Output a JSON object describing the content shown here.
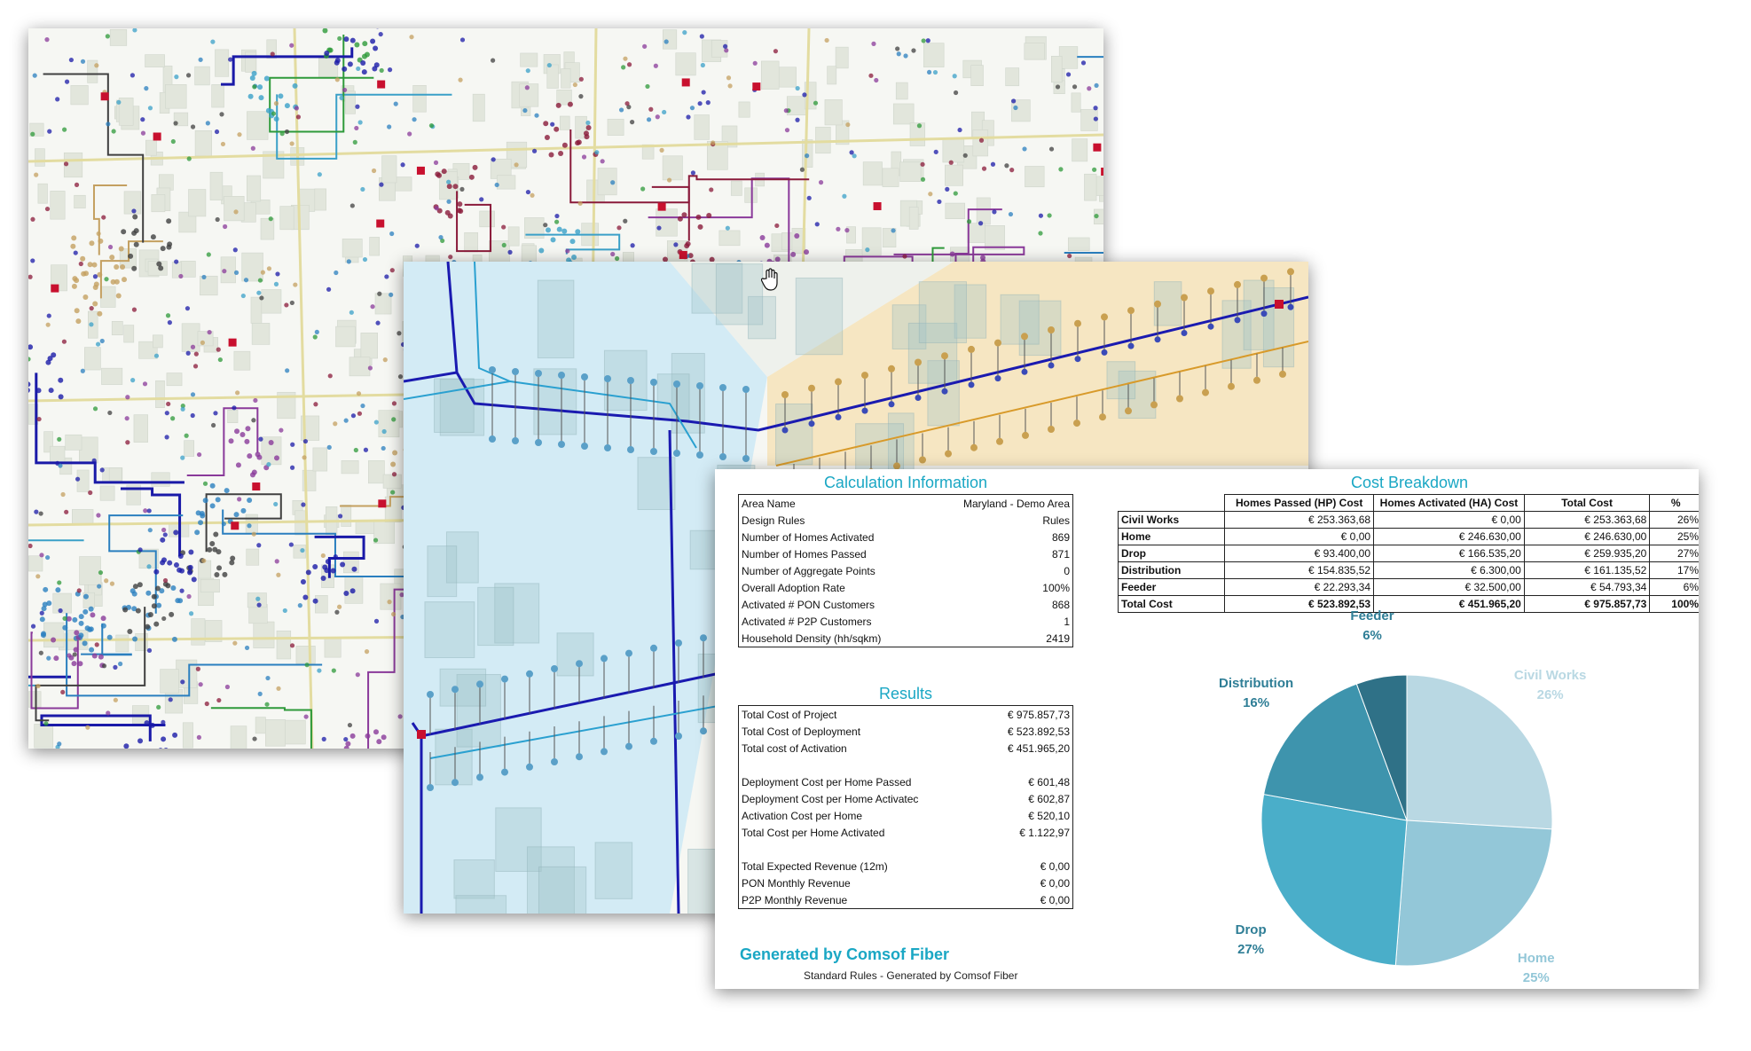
{
  "calculation": {
    "title": "Calculation Information",
    "rows": [
      {
        "label": "Area Name",
        "value": "Maryland - Demo Area"
      },
      {
        "label": "Design Rules",
        "value": "Rules"
      },
      {
        "label": "Number of Homes Activated",
        "value": "869"
      },
      {
        "label": "Number of Homes Passed",
        "value": "871"
      },
      {
        "label": "Number of Aggregate Points",
        "value": "0"
      },
      {
        "label": "Overall Adoption Rate",
        "value": "100%"
      },
      {
        "label": "Activated # PON Customers",
        "value": "868"
      },
      {
        "label": "Activated # P2P Customers",
        "value": "1"
      },
      {
        "label": "Household Density (hh/sqkm)",
        "value": "2419"
      }
    ]
  },
  "results": {
    "title": "Results",
    "rows": [
      {
        "label": "Total Cost of Project",
        "value": "€ 975.857,73"
      },
      {
        "label": "Total Cost of Deployment",
        "value": "€ 523.892,53"
      },
      {
        "label": "Total cost of Activation",
        "value": "€ 451.965,20"
      },
      {
        "label": "",
        "value": ""
      },
      {
        "label": "Deployment Cost per Home Passed",
        "value": "€ 601,48"
      },
      {
        "label": "Deployment Cost per Home Activatec",
        "value": "€ 602,87"
      },
      {
        "label": "Activation Cost per Home",
        "value": "€ 520,10"
      },
      {
        "label": "Total Cost per Home Activated",
        "value": "€ 1.122,97"
      },
      {
        "label": "",
        "value": ""
      },
      {
        "label": "Total Expected Revenue (12m)",
        "value": "€ 0,00"
      },
      {
        "label": "PON Monthly Revenue",
        "value": "€ 0,00"
      },
      {
        "label": "P2P Monthly Revenue",
        "value": "€ 0,00"
      }
    ]
  },
  "cost_breakdown": {
    "title": "Cost Breakdown",
    "headers": [
      "Homes Passed (HP) Cost",
      "Homes Activated (HA) Cost",
      "Total Cost",
      "%"
    ],
    "rows": [
      {
        "label": "Civil Works",
        "hp": "€ 253.363,68",
        "ha": "€ 0,00",
        "total": "€ 253.363,68",
        "pct": "26%"
      },
      {
        "label": "Home",
        "hp": "€ 0,00",
        "ha": "€ 246.630,00",
        "total": "€ 246.630,00",
        "pct": "25%"
      },
      {
        "label": "Drop",
        "hp": "€ 93.400,00",
        "ha": "€ 166.535,20",
        "total": "€ 259.935,20",
        "pct": "27%"
      },
      {
        "label": "Distribution",
        "hp": "€ 154.835,52",
        "ha": "€ 6.300,00",
        "total": "€ 161.135,52",
        "pct": "17%"
      },
      {
        "label": "Feeder",
        "hp": "€ 22.293,34",
        "ha": "€ 32.500,00",
        "total": "€ 54.793,34",
        "pct": "6%"
      },
      {
        "label": "Total Cost",
        "hp": "€ 523.892,53",
        "ha": "€ 451.965,20",
        "total": "€ 975.857,73",
        "pct": "100%"
      }
    ]
  },
  "footer": {
    "title": "Generated by Comsof Fiber",
    "subtitle": "Standard Rules - Generated by Comsof Fiber"
  },
  "cursor": {
    "icon": "hand-cursor-icon"
  },
  "chart_data": {
    "type": "pie",
    "title": "",
    "slices": [
      {
        "name": "Civil Works",
        "value": 253363.68,
        "pct_label": "26%",
        "color": "#b9d8e3"
      },
      {
        "name": "Home",
        "value": 246630.0,
        "pct_label": "25%",
        "color": "#93c7d8"
      },
      {
        "name": "Drop",
        "value": 259935.2,
        "pct_label": "27%",
        "color": "#4aaec9"
      },
      {
        "name": "Distribution",
        "value": 161135.52,
        "pct_label": "16%",
        "color": "#3e94ad"
      },
      {
        "name": "Feeder",
        "value": 54793.34,
        "pct_label": "6%",
        "color": "#2f7187"
      }
    ],
    "legend": "none"
  }
}
